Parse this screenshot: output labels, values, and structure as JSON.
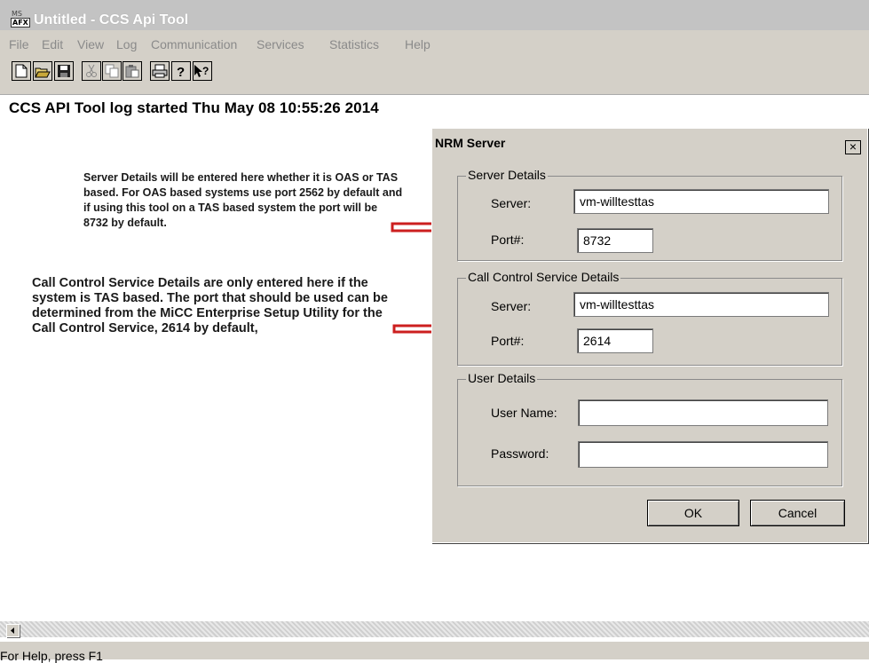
{
  "window": {
    "title": "Untitled - CCS Api Tool",
    "icon_top": "MS",
    "icon_bottom": "AFX"
  },
  "menu": [
    "File",
    "Edit",
    "View",
    "Log",
    "Communication",
    "Services",
    "Statistics",
    "Help"
  ],
  "toolbar": [
    "new-file-icon",
    "open-folder-icon",
    "save-disk-icon",
    "cut-icon",
    "copy-icon",
    "paste-icon",
    "print-icon",
    "about-icon",
    "context-help-icon"
  ],
  "log": {
    "line": "CCS API Tool log started Thu May 08 10:55:26 2014"
  },
  "annotations": {
    "note1": "Server Details will be entered here whether it is OAS or TAS based.  For OAS based systems use port 2562 by default and if using this tool on a TAS based system the port will be 8732 by default.",
    "note2": "Call Control Service Details are only entered here if the system is TAS based.  The port that should be used can be determined from the MiCC Enterprise Setup Utility for the Call Control Service, 2614 by default,",
    "arrow_color": "#cc1f1f"
  },
  "dialog": {
    "title": "NRM Server",
    "close": "×",
    "server_details": {
      "legend": "Server Details",
      "server_label": "Server:",
      "server_value": "vm-willtesttas",
      "port_label": "Port#:",
      "port_value": "8732"
    },
    "call_control": {
      "legend": "Call Control Service Details",
      "server_label": "Server:",
      "server_value": "vm-willtesttas",
      "port_label": "Port#:",
      "port_value": "2614"
    },
    "user_details": {
      "legend": "User Details",
      "username_label": "User Name:",
      "username_value": "",
      "password_label": "Password:",
      "password_value": ""
    },
    "ok_label": "OK",
    "cancel_label": "Cancel"
  },
  "status": {
    "text": "For Help, press F1"
  }
}
